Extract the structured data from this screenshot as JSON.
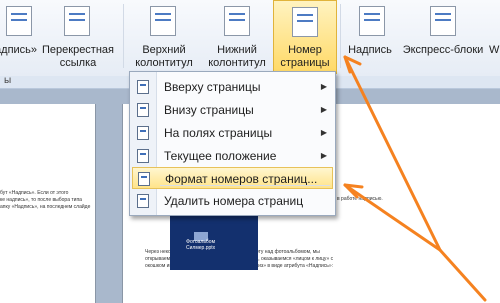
{
  "ribbon": {
    "buttons": [
      {
        "line1": "надпись»",
        "line2": ""
      },
      {
        "line1": "Перекрестная",
        "line2": "ссылка"
      },
      {
        "line1": "Верхний",
        "line2": "колонтитул"
      },
      {
        "line1": "Нижний",
        "line2": "колонтитул"
      },
      {
        "line1": "Номер",
        "line2": "страницы"
      },
      {
        "line1": "Надпись",
        "line2": ""
      },
      {
        "line1": "Экспресс-блоки",
        "line2": ""
      },
      {
        "line1": "W",
        "line2": ""
      }
    ],
    "group_label_fragment": "ы",
    "dropdown_glyph": "▾"
  },
  "menu": {
    "items": [
      {
        "label": "Вверху страницы",
        "submenu": true
      },
      {
        "label": "Внизу страницы",
        "submenu": true
      },
      {
        "label": "На полях страницы",
        "submenu": true
      },
      {
        "label": "Текущее положение",
        "submenu": true
      },
      {
        "label": "Формат номеров страниц...",
        "submenu": false
      },
      {
        "label": "Удалить номера страниц",
        "submenu": false
      }
    ],
    "submenu_glyph": "▶"
  },
  "document": {
    "left_lines": [
      "бут «Надпись». Если от этого",
      "ке надпись», то после выбора типа",
      "апку «Надпись», на последнем слайде"
    ],
    "right_line": "в работе надписью.",
    "thumb_caption_1": "Фотоальбом",
    "thumb_caption_2": "Силмер.pptx",
    "body_lines": [
      "Через некоторое время, желая продолжить работу над фотоальбомом, мы",
      "открываем файл и далее шаг за шагом, наконец, оказываемся «лицом к лицу» с",
      "окошком инструментария. А здесь опять «сюрприз» в виде атрибута «Надпись»:"
    ]
  },
  "colors": {
    "annotation": "#f58220",
    "highlight": "#ffe48a",
    "ribbon": "#e6ecf5"
  }
}
